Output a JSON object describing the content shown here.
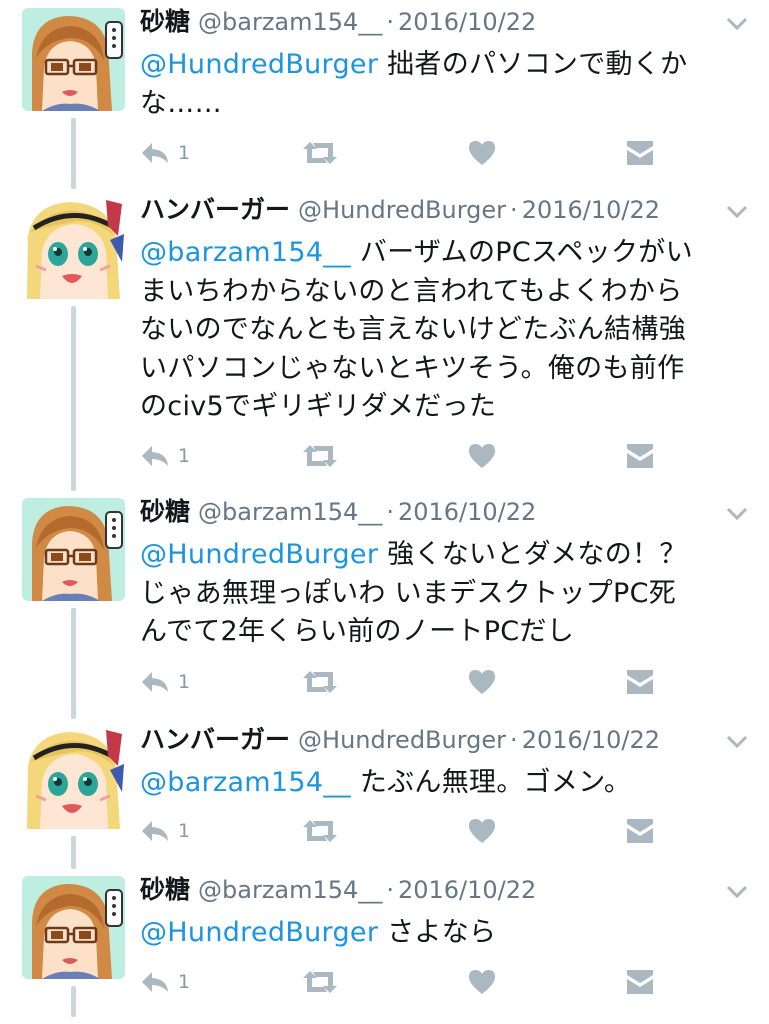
{
  "thread": {
    "tweets": [
      {
        "display_name": "砂糖",
        "handle": "@barzam154__",
        "separator": "·",
        "date": "2016/10/22",
        "avatar": "sato",
        "lines": [
          {
            "mention": "@HundredBurger",
            "text": " 拙者のパソコンで動くか"
          },
          {
            "mention": "",
            "text": "な……"
          }
        ],
        "reply_count": "1"
      },
      {
        "display_name": "ハンバーガー",
        "handle": "@HundredBurger",
        "separator": "·",
        "date": "2016/10/22",
        "avatar": "burger",
        "lines": [
          {
            "mention": "@barzam154__",
            "text": " バーザムのPCスペックがい"
          },
          {
            "mention": "",
            "text": "まいちわからないのと言われてもよくわから"
          },
          {
            "mention": "",
            "text": "ないのでなんとも言えないけどたぶん結構強"
          },
          {
            "mention": "",
            "text": "いパソコンじゃないとキツそう。俺のも前作"
          },
          {
            "mention": "",
            "text": "のciv5でギリギリダメだった"
          }
        ],
        "reply_count": "1"
      },
      {
        "display_name": "砂糖",
        "handle": "@barzam154__",
        "separator": "·",
        "date": "2016/10/22",
        "avatar": "sato",
        "lines": [
          {
            "mention": "@HundredBurger",
            "text": " 強くないとダメなの！？"
          },
          {
            "mention": "",
            "text": "じゃあ無理っぽいわ いまデスクトップPC死"
          },
          {
            "mention": "",
            "text": "んでて2年くらい前のノートPCだし"
          }
        ],
        "reply_count": "1"
      },
      {
        "display_name": "ハンバーガー",
        "handle": "@HundredBurger",
        "separator": "·",
        "date": "2016/10/22",
        "avatar": "burger",
        "lines": [
          {
            "mention": "@barzam154__",
            "text": " たぶん無理。ゴメン。"
          }
        ],
        "reply_count": "1"
      },
      {
        "display_name": "砂糖",
        "handle": "@barzam154__",
        "separator": "·",
        "date": "2016/10/22",
        "avatar": "sato",
        "lines": [
          {
            "mention": "@HundredBurger",
            "text": " さよなら"
          }
        ],
        "reply_count": "1"
      }
    ]
  },
  "icons": {
    "reply": "reply-icon",
    "retweet": "retweet-icon",
    "like": "heart-icon",
    "dm": "direct-message-icon",
    "more": "chevron-down-icon"
  },
  "colors": {
    "mention": "#1b95e0",
    "icon": "#aab8c2",
    "thread_line": "#ccd6dd",
    "meta": "#657786"
  }
}
